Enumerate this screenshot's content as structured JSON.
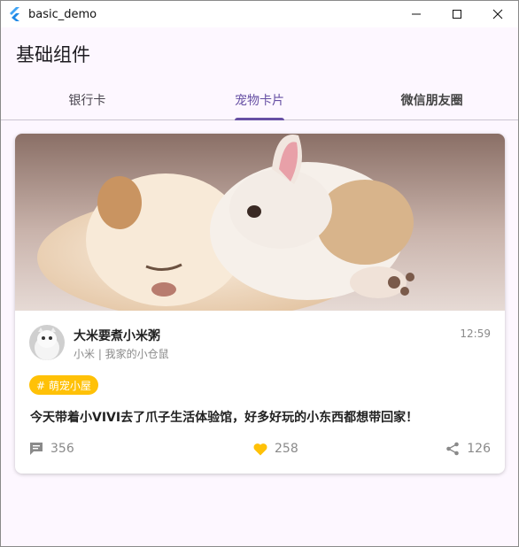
{
  "window": {
    "title": "basic_demo"
  },
  "appbar": {
    "title": "基础组件"
  },
  "tabs": [
    {
      "label": "银行卡"
    },
    {
      "label": "宠物卡片"
    },
    {
      "label": "微信朋友圈"
    }
  ],
  "active_tab": "宠物卡片",
  "card": {
    "author": {
      "name": "大米要煮小米粥",
      "subtitle": "小米 | 我家的小仓鼠"
    },
    "time": "12:59",
    "tag": "# 萌宠小屋",
    "content": "今天带着小VIVI去了爪子生活体验馆，好多好玩的小东西都想带回家！",
    "stats": {
      "comments": "356",
      "likes": "258",
      "shares": "126"
    }
  },
  "colors": {
    "accent": "#6750a4",
    "tag_bg": "#ffc107",
    "like": "#ffc107",
    "background": "#fdf7ff"
  }
}
